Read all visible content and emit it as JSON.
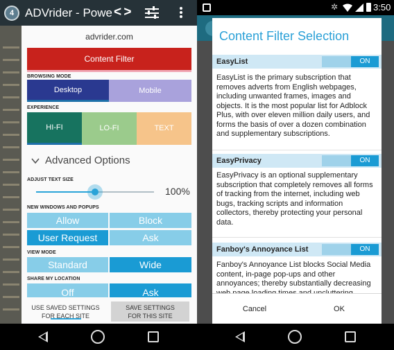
{
  "left": {
    "app_title": "ADVrider - Powe",
    "domain": "advrider.com",
    "content_filter_label": "Content Filter",
    "browsing_mode": {
      "heading": "BROWSING MODE",
      "desktop": "Desktop",
      "mobile": "Mobile",
      "selected": "Desktop"
    },
    "experience": {
      "heading": "EXPERIENCE",
      "hifi": "HI-FI",
      "lofi": "LO-FI",
      "text": "TEXT",
      "selected": "HI-FI"
    },
    "advanced_options": "Advanced Options",
    "text_size": {
      "heading": "ADJUST TEXT SIZE",
      "value_label": "100%",
      "fraction": 0.5
    },
    "popups": {
      "heading": "NEW WINDOWS AND POPUPS",
      "allow": "Allow",
      "block": "Block",
      "user_request": "User Request",
      "ask": "Ask",
      "selected": "User Request"
    },
    "view_mode": {
      "heading": "VIEW MODE",
      "standard": "Standard",
      "wide": "Wide",
      "selected": "Wide"
    },
    "location": {
      "heading": "SHARE MY LOCATION",
      "off": "Off",
      "ask": "Ask",
      "selected": "Ask"
    },
    "use_saved_line1": "USE SAVED SETTINGS",
    "use_saved_line2": "FOR EACH SITE",
    "save_settings_line1": "SAVE SETTINGS",
    "save_settings_line2": "FOR THIS SITE"
  },
  "right": {
    "status_time": "3:50",
    "dialog_title": "Content Filter Selection",
    "filters": [
      {
        "name": "EasyList",
        "toggle": "ON",
        "description": "EasyList is the primary subscription that removes adverts from English webpages, including unwanted frames, images and objects. It is the most popular list for Adblock Plus, with over eleven million daily users, and forms the basis of over a dozen combination and supplementary subscriptions."
      },
      {
        "name": "EasyPrivacy",
        "toggle": "ON",
        "description": "EasyPrivacy is an optional supplementary subscription that completely removes all forms of tracking from the internet, including web bugs, tracking scripts and information collectors, thereby protecting your personal data."
      },
      {
        "name": "Fanboy's Annoyance List",
        "toggle": "ON",
        "description": "Fanboy's Annoyance List blocks Social Media content, in-page pop-ups and other annoyances; thereby substantially decreasing web page loading times and uncluttering"
      }
    ],
    "cancel_label": "Cancel",
    "ok_label": "OK"
  },
  "colors": {
    "accent_red": "#c8221c",
    "accent_blue": "#1a9bd4",
    "light_blue": "#87cde8",
    "navy": "#2a3990",
    "lavender": "#a9a2dc",
    "hifi_green": "#17735f",
    "lofi_green": "#9bcb8c",
    "text_orange": "#f6c48a",
    "dialog_title": "#2aa0d7"
  },
  "icons": [
    "app-logo-icon",
    "code-view-icon",
    "settings-tune-icon",
    "more-vert-icon",
    "chevron-down-icon",
    "back-icon",
    "home-icon",
    "recents-icon",
    "notification-icon",
    "bluetooth-icon",
    "wifi-icon",
    "cellular-icon",
    "battery-icon"
  ]
}
